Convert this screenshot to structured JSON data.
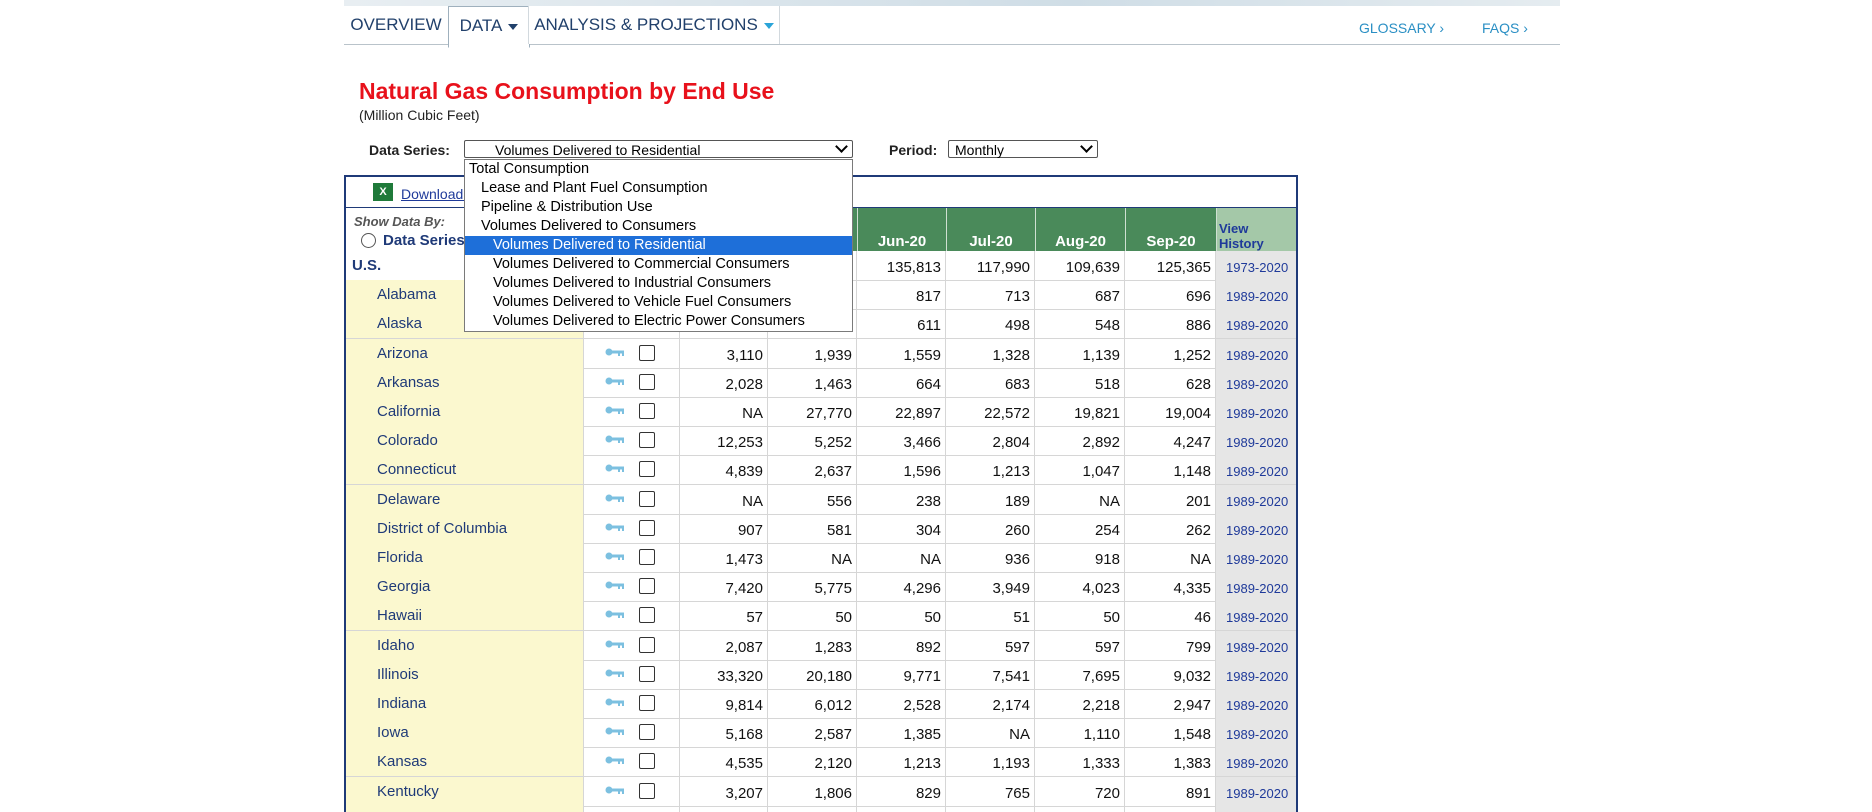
{
  "nav": {
    "tabs": [
      {
        "label": "OVERVIEW",
        "caret": false
      },
      {
        "label": "DATA",
        "caret": true
      },
      {
        "label": "ANALYSIS & PROJECTIONS",
        "caret": true
      }
    ],
    "links": [
      "GLOSSARY ›",
      "FAQS ›"
    ]
  },
  "page": {
    "title": "Natural Gas Consumption by End Use",
    "subtitle": "(Million Cubic Feet)"
  },
  "controls": {
    "data_series_label": "Data Series:",
    "data_series_value": "Volumes Delivered to Residential",
    "period_label": "Period:",
    "period_value": "Monthly"
  },
  "dropdown": {
    "options": [
      {
        "label": "Total Consumption",
        "indent": 0,
        "selected": false
      },
      {
        "label": "Lease and Plant Fuel Consumption",
        "indent": 1,
        "selected": false
      },
      {
        "label": "Pipeline & Distribution Use",
        "indent": 1,
        "selected": false
      },
      {
        "label": "Volumes Delivered to Consumers",
        "indent": 1,
        "selected": false
      },
      {
        "label": "Volumes Delivered to Residential",
        "indent": 2,
        "selected": true
      },
      {
        "label": "Volumes Delivered to Commercial Consumers",
        "indent": 2,
        "selected": false
      },
      {
        "label": "Volumes Delivered to Industrial Consumers",
        "indent": 2,
        "selected": false
      },
      {
        "label": "Volumes Delivered to Vehicle Fuel Consumers",
        "indent": 2,
        "selected": false
      },
      {
        "label": "Volumes Delivered to Electric Power Consumers",
        "indent": 2,
        "selected": false
      }
    ]
  },
  "table": {
    "download_label": "Download S",
    "show_by_label": "Show Data By:",
    "radio_label": "Data Series",
    "columns": [
      "Jun-20",
      "Jul-20",
      "Aug-20",
      "Sep-20"
    ],
    "view_history": "View History",
    "rows": [
      {
        "name": "U.S.",
        "values": [
          "",
          "",
          "135,813",
          "117,990",
          "109,639",
          "125,365"
        ],
        "history": "1973-2020"
      },
      {
        "name": "Alabama",
        "values": [
          "",
          "",
          "817",
          "713",
          "687",
          "696"
        ],
        "history": "1989-2020"
      },
      {
        "name": "Alaska",
        "values": [
          "",
          "",
          "611",
          "498",
          "548",
          "886"
        ],
        "history": "1989-2020"
      },
      {
        "name": "Arizona",
        "values": [
          "3,110",
          "1,939",
          "1,559",
          "1,328",
          "1,139",
          "1,252"
        ],
        "history": "1989-2020"
      },
      {
        "name": "Arkansas",
        "values": [
          "2,028",
          "1,463",
          "664",
          "683",
          "518",
          "628"
        ],
        "history": "1989-2020"
      },
      {
        "name": "California",
        "values": [
          "NA",
          "27,770",
          "22,897",
          "22,572",
          "19,821",
          "19,004"
        ],
        "history": "1989-2020"
      },
      {
        "name": "Colorado",
        "values": [
          "12,253",
          "5,252",
          "3,466",
          "2,804",
          "2,892",
          "4,247"
        ],
        "history": "1989-2020"
      },
      {
        "name": "Connecticut",
        "values": [
          "4,839",
          "2,637",
          "1,596",
          "1,213",
          "1,047",
          "1,148"
        ],
        "history": "1989-2020"
      },
      {
        "name": "Delaware",
        "values": [
          "NA",
          "556",
          "238",
          "189",
          "NA",
          "201"
        ],
        "history": "1989-2020"
      },
      {
        "name": "District of Columbia",
        "values": [
          "907",
          "581",
          "304",
          "260",
          "254",
          "262"
        ],
        "history": "1989-2020"
      },
      {
        "name": "Florida",
        "values": [
          "1,473",
          "NA",
          "NA",
          "936",
          "918",
          "NA"
        ],
        "history": "1989-2020"
      },
      {
        "name": "Georgia",
        "values": [
          "7,420",
          "5,775",
          "4,296",
          "3,949",
          "4,023",
          "4,335"
        ],
        "history": "1989-2020"
      },
      {
        "name": "Hawaii",
        "values": [
          "57",
          "50",
          "50",
          "51",
          "50",
          "46"
        ],
        "history": "1989-2020"
      },
      {
        "name": "Idaho",
        "values": [
          "2,087",
          "1,283",
          "892",
          "597",
          "597",
          "799"
        ],
        "history": "1989-2020"
      },
      {
        "name": "Illinois",
        "values": [
          "33,320",
          "20,180",
          "9,771",
          "7,541",
          "7,695",
          "9,032"
        ],
        "history": "1989-2020"
      },
      {
        "name": "Indiana",
        "values": [
          "9,814",
          "6,012",
          "2,528",
          "2,174",
          "2,218",
          "2,947"
        ],
        "history": "1989-2020"
      },
      {
        "name": "Iowa",
        "values": [
          "5,168",
          "2,587",
          "1,385",
          "NA",
          "1,110",
          "1,548"
        ],
        "history": "1989-2020"
      },
      {
        "name": "Kansas",
        "values": [
          "4,535",
          "2,120",
          "1,213",
          "1,193",
          "1,333",
          "1,383"
        ],
        "history": "1989-2020"
      },
      {
        "name": "Kentucky",
        "values": [
          "3,207",
          "1,806",
          "829",
          "765",
          "720",
          "891"
        ],
        "history": "1989-2020"
      },
      {
        "name": "",
        "values": [
          "",
          "",
          "",
          "",
          "",
          ""
        ],
        "history": ""
      }
    ]
  }
}
